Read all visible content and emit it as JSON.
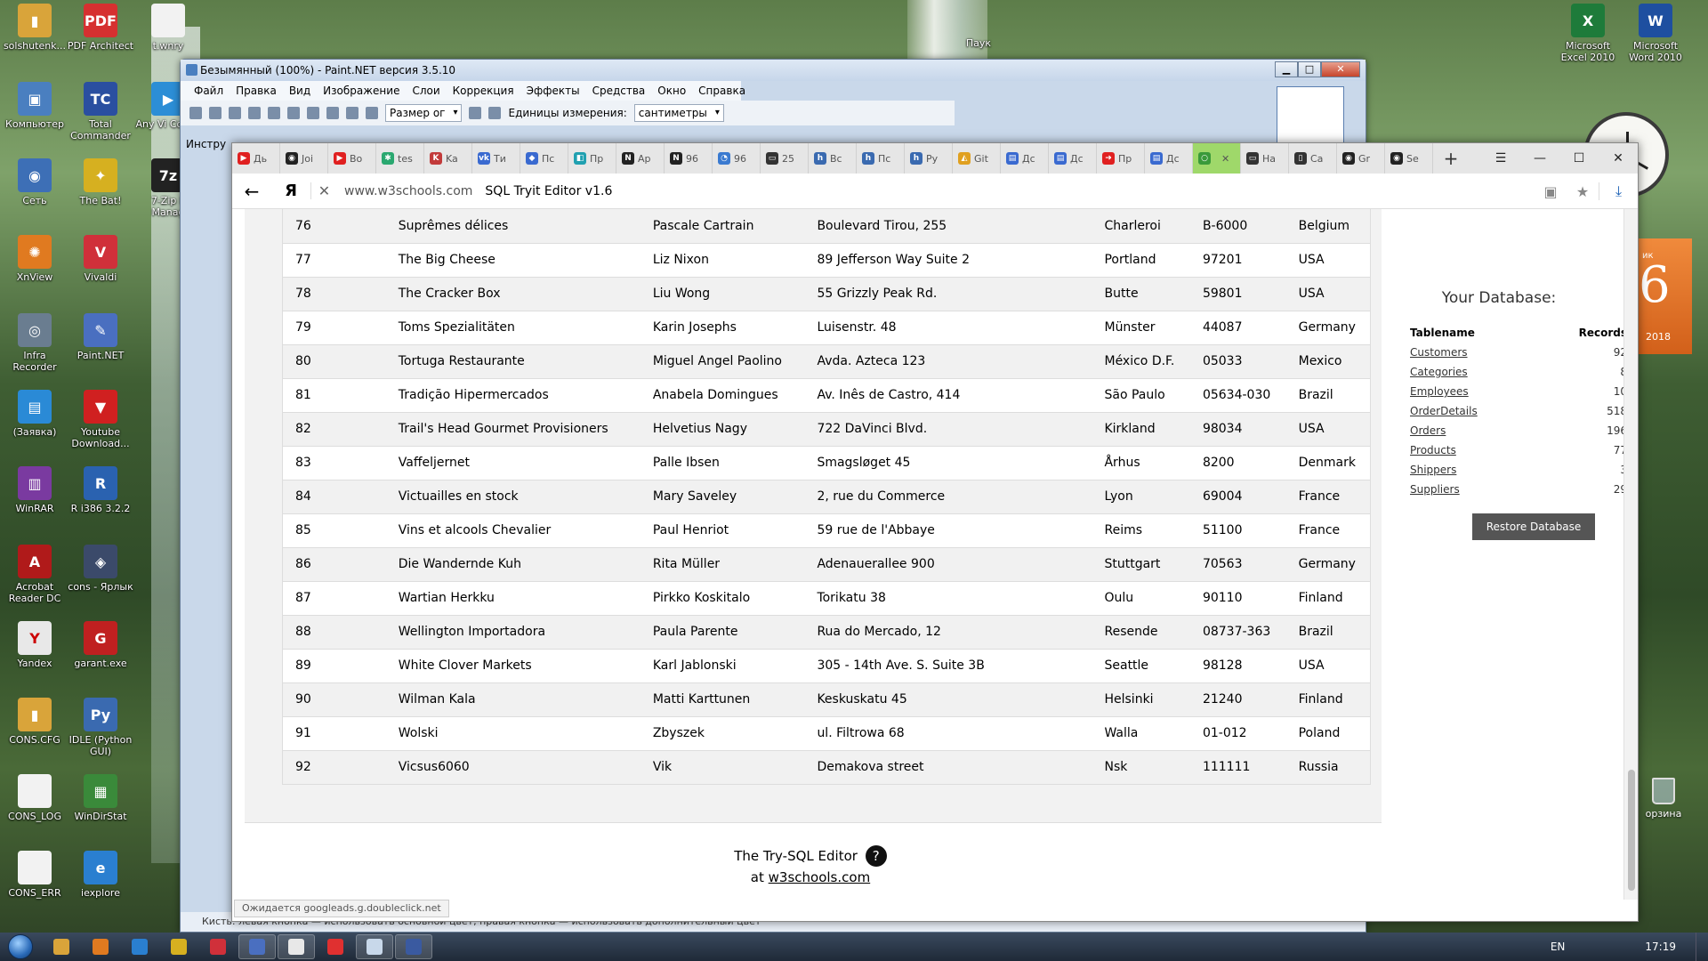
{
  "desktop": {
    "icons": [
      {
        "label": "solshutenk...",
        "color": "#d9a43a",
        "glyph": "▮",
        "icon": "folder-icon"
      },
      {
        "label": "PDF Architect",
        "color": "#d63030",
        "glyph": "PDF",
        "icon": "pdf-architect-icon"
      },
      {
        "label": "t.wnry",
        "color": "#f2f2f2",
        "glyph": "",
        "icon": "file-icon"
      },
      {
        "label": "Компьютер",
        "color": "#4a7fc0",
        "glyph": "▣",
        "icon": "computer-icon"
      },
      {
        "label": "Total Commander",
        "color": "#2a4fa0",
        "glyph": "TC",
        "icon": "total-commander-icon"
      },
      {
        "label": "Any Vi Conve",
        "color": "#2c8ed6",
        "glyph": "▶",
        "icon": "any-video-converter-icon"
      },
      {
        "label": "Сеть",
        "color": "#3d6fb6",
        "glyph": "◉",
        "icon": "network-icon"
      },
      {
        "label": "The Bat!",
        "color": "#d6b020",
        "glyph": "✦",
        "icon": "the-bat-icon"
      },
      {
        "label": "7-Zip F Manag",
        "color": "#222",
        "glyph": "7z",
        "icon": "7zip-icon"
      },
      {
        "label": "XnView",
        "color": "#e07a20",
        "glyph": "✺",
        "icon": "xnview-icon"
      },
      {
        "label": "Vivaldi",
        "color": "#d0303a",
        "glyph": "V",
        "icon": "vivaldi-icon"
      },
      {
        "label": "Infra Recorder",
        "color": "#6a7d90",
        "glyph": "◎",
        "icon": "infra-recorder-icon"
      },
      {
        "label": "Paint.NET",
        "color": "#4a6fc0",
        "glyph": "✎",
        "icon": "paintnet-icon"
      },
      {
        "label": "(Заявка)",
        "color": "#2a8ad6",
        "glyph": "▤",
        "icon": "document-icon"
      },
      {
        "label": "Youtube Download...",
        "color": "#d02020",
        "glyph": "▼",
        "icon": "youtube-downloader-icon"
      },
      {
        "label": "WinRAR",
        "color": "#7a3aa0",
        "glyph": "▥",
        "icon": "winrar-icon"
      },
      {
        "label": "R i386 3.2.2",
        "color": "#2a62b0",
        "glyph": "R",
        "icon": "r-icon"
      },
      {
        "label": "Acrobat Reader DC",
        "color": "#b01a1a",
        "glyph": "A",
        "icon": "acrobat-icon"
      },
      {
        "label": "cons - Ярлык",
        "color": "#3b4a6a",
        "glyph": "◈",
        "icon": "shortcut-icon"
      },
      {
        "label": "Yandex",
        "color": "#e8e8e8",
        "glyph": "Y",
        "icon": "yandex-icon"
      },
      {
        "label": "garant.exe",
        "color": "#c02020",
        "glyph": "G",
        "icon": "garant-icon"
      },
      {
        "label": "CONS.CFG",
        "color": "#d9a43a",
        "glyph": "▮",
        "icon": "folder-icon"
      },
      {
        "label": "IDLE (Python GUI)",
        "color": "#3a6ab0",
        "glyph": "Py",
        "icon": "python-icon"
      },
      {
        "label": "CONS_LOG",
        "color": "#f2f2f2",
        "glyph": "",
        "icon": "file-icon"
      },
      {
        "label": "WinDirStat",
        "color": "#3a8a3a",
        "glyph": "▦",
        "icon": "windirstat-icon"
      },
      {
        "label": "CONS_ERR",
        "color": "#f2f2f2",
        "glyph": "",
        "icon": "file-icon"
      },
      {
        "label": "iexplore",
        "color": "#2a7fd0",
        "glyph": "e",
        "icon": "ie-icon"
      }
    ],
    "right_icons": [
      {
        "label": "Microsoft Excel 2010",
        "color": "#1e7b3a",
        "glyph": "X",
        "icon": "excel-icon"
      },
      {
        "label": "Microsoft Word 2010",
        "color": "#1e4fa0",
        "glyph": "W",
        "icon": "word-icon"
      }
    ],
    "top_label": "Паук",
    "recycle_label": "орзина",
    "calendar": {
      "month": "ик",
      "day": "6",
      "year": "2018"
    }
  },
  "paint": {
    "title": "Безымянный (100%) - Paint.NET версия 3.5.10",
    "menu": [
      "Файл",
      "Правка",
      "Вид",
      "Изображение",
      "Слои",
      "Коррекция",
      "Эффекты",
      "Средства",
      "Окно",
      "Справка"
    ],
    "size_label": "Размер ог",
    "units_label": "Единицы измерения:",
    "units_value": "сантиметры",
    "tools_label": "Инстру",
    "status_text": "Кисть: левая кнопка — использовать основной цвет, правая кнопка — использовать дополнительный цвет"
  },
  "browser": {
    "tabs": [
      {
        "label": "Дь",
        "color": "#e02020",
        "glyph": "▶"
      },
      {
        "label": "Joi",
        "color": "#222",
        "glyph": "◉"
      },
      {
        "label": "Во",
        "color": "#e02020",
        "glyph": "▶"
      },
      {
        "label": "tes",
        "color": "#2aa870",
        "glyph": "✱"
      },
      {
        "label": "Ka",
        "color": "#c23a3a",
        "glyph": "K"
      },
      {
        "label": "Ти",
        "color": "#3a6ad0",
        "glyph": "vk"
      },
      {
        "label": "Пс",
        "color": "#3a6ad0",
        "glyph": "◆"
      },
      {
        "label": "Пр",
        "color": "#20a0b0",
        "glyph": "◧"
      },
      {
        "label": "Ар",
        "color": "#222",
        "glyph": "N"
      },
      {
        "label": "96",
        "color": "#222",
        "glyph": "N"
      },
      {
        "label": "96",
        "color": "#3a7ad0",
        "glyph": "◔"
      },
      {
        "label": "25",
        "color": "#333",
        "glyph": "▭"
      },
      {
        "label": "Вс",
        "color": "#3a6ab0",
        "glyph": "h"
      },
      {
        "label": "Пс",
        "color": "#3a6ab0",
        "glyph": "h"
      },
      {
        "label": "Ру",
        "color": "#3a6ab0",
        "glyph": "h"
      },
      {
        "label": "Git",
        "color": "#e0a020",
        "glyph": "◭"
      },
      {
        "label": "Дс",
        "color": "#3a6ad0",
        "glyph": "▤"
      },
      {
        "label": "Дс",
        "color": "#3a6ad0",
        "glyph": "▤"
      },
      {
        "label": "Пр",
        "color": "#e02020",
        "glyph": "➜"
      },
      {
        "label": "Дс",
        "color": "#3a6ad0",
        "glyph": "▤"
      },
      {
        "label": "",
        "color": "#3a9a3a",
        "glyph": "○",
        "active": true
      },
      {
        "label": "На",
        "color": "#333",
        "glyph": "▭"
      },
      {
        "label": "Са",
        "color": "#333",
        "glyph": "▯"
      },
      {
        "label": "Gr",
        "color": "#222",
        "glyph": "◉"
      },
      {
        "label": "Se",
        "color": "#222",
        "glyph": "◉"
      }
    ],
    "domain": "www.w3schools.com",
    "page_title": "SQL Tryit Editor v1.6",
    "status_text": "Ожидается googleads.g.doubleclick.net"
  },
  "results": {
    "rows": [
      [
        "76",
        "Suprêmes délices",
        "Pascale Cartrain",
        "Boulevard Tirou, 255",
        "Charleroi",
        "B-6000",
        "Belgium"
      ],
      [
        "77",
        "The Big Cheese",
        "Liz Nixon",
        "89 Jefferson Way Suite 2",
        "Portland",
        "97201",
        "USA"
      ],
      [
        "78",
        "The Cracker Box",
        "Liu Wong",
        "55 Grizzly Peak Rd.",
        "Butte",
        "59801",
        "USA"
      ],
      [
        "79",
        "Toms Spezialitäten",
        "Karin Josephs",
        "Luisenstr. 48",
        "Münster",
        "44087",
        "Germany"
      ],
      [
        "80",
        "Tortuga Restaurante",
        "Miguel Angel Paolino",
        "Avda. Azteca 123",
        "México D.F.",
        "05033",
        "Mexico"
      ],
      [
        "81",
        "Tradição Hipermercados",
        "Anabela Domingues",
        "Av. Inês de Castro, 414",
        "São Paulo",
        "05634-030",
        "Brazil"
      ],
      [
        "82",
        "Trail's Head Gourmet Provisioners",
        "Helvetius Nagy",
        "722 DaVinci Blvd.",
        "Kirkland",
        "98034",
        "USA"
      ],
      [
        "83",
        "Vaffeljernet",
        "Palle Ibsen",
        "Smagsløget 45",
        "Århus",
        "8200",
        "Denmark"
      ],
      [
        "84",
        "Victuailles en stock",
        "Mary Saveley",
        "2, rue du Commerce",
        "Lyon",
        "69004",
        "France"
      ],
      [
        "85",
        "Vins et alcools Chevalier",
        "Paul Henriot",
        "59 rue de l'Abbaye",
        "Reims",
        "51100",
        "France"
      ],
      [
        "86",
        "Die Wandernde Kuh",
        "Rita Müller",
        "Adenauerallee 900",
        "Stuttgart",
        "70563",
        "Germany"
      ],
      [
        "87",
        "Wartian Herkku",
        "Pirkko Koskitalo",
        "Torikatu 38",
        "Oulu",
        "90110",
        "Finland"
      ],
      [
        "88",
        "Wellington Importadora",
        "Paula Parente",
        "Rua do Mercado, 12",
        "Resende",
        "08737-363",
        "Brazil"
      ],
      [
        "89",
        "White Clover Markets",
        "Karl Jablonski",
        "305 - 14th Ave. S. Suite 3B",
        "Seattle",
        "98128",
        "USA"
      ],
      [
        "90",
        "Wilman Kala",
        "Matti Karttunen",
        "Keskuskatu 45",
        "Helsinki",
        "21240",
        "Finland"
      ],
      [
        "91",
        "Wolski",
        "Zbyszek",
        "ul. Filtrowa 68",
        "Walla",
        "01-012",
        "Poland"
      ],
      [
        "92",
        "Vicsus6060",
        "Vik",
        "Demakova street",
        "Nsk",
        "111111",
        "Russia"
      ]
    ]
  },
  "database": {
    "title": "Your Database:",
    "col_table": "Tablename",
    "col_records": "Records",
    "tables": [
      {
        "name": "Customers",
        "records": "92"
      },
      {
        "name": "Categories",
        "records": "8"
      },
      {
        "name": "Employees",
        "records": "10"
      },
      {
        "name": "OrderDetails",
        "records": "518"
      },
      {
        "name": "Orders",
        "records": "196"
      },
      {
        "name": "Products",
        "records": "77"
      },
      {
        "name": "Shippers",
        "records": "3"
      },
      {
        "name": "Suppliers",
        "records": "29"
      }
    ],
    "restore_label": "Restore Database"
  },
  "footer": {
    "line1": "The Try-SQL Editor",
    "help_glyph": "?",
    "at": "at",
    "link": "w3schools.com"
  },
  "taskbar": {
    "apps": [
      {
        "color": "#d9a43a",
        "icon": "explorer-icon"
      },
      {
        "color": "#e07a20",
        "icon": "media-player-icon"
      },
      {
        "color": "#2a7fd0",
        "icon": "ie-icon"
      },
      {
        "color": "#d6b020",
        "icon": "the-bat-icon"
      },
      {
        "color": "#d0303a",
        "icon": "vivaldi-icon"
      },
      {
        "color": "#4a6fc0",
        "icon": "paintnet-icon",
        "running": true
      },
      {
        "color": "#e8e8e8",
        "icon": "yandex-icon",
        "running": true
      },
      {
        "color": "#e03030",
        "icon": "yandex-browser-icon"
      },
      {
        "color": "#c8d8ea",
        "icon": "window-icon",
        "running": true
      },
      {
        "color": "#3a5aa0",
        "icon": "app-icon",
        "running": true
      }
    ],
    "lang": "EN",
    "time": "17:19"
  }
}
